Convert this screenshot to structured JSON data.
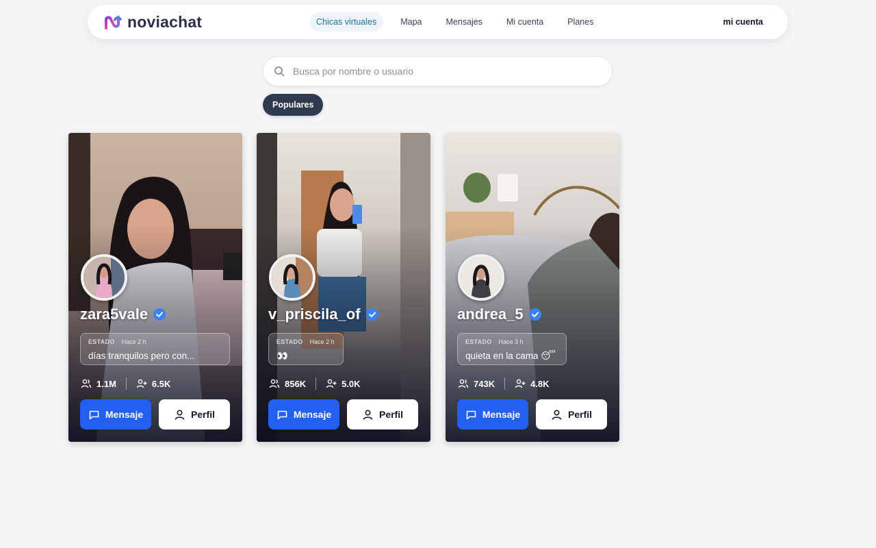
{
  "brand": {
    "name": "noviachat"
  },
  "nav": {
    "links": [
      {
        "label": "Chicas virtuales",
        "active": true
      },
      {
        "label": "Mapa",
        "active": false
      },
      {
        "label": "Mensajes",
        "active": false
      },
      {
        "label": "Mi cuenta",
        "active": false
      },
      {
        "label": "Planes",
        "active": false
      }
    ],
    "account_label": "mi cuenta"
  },
  "search": {
    "placeholder": "Busca por nombre o usuario",
    "value": ""
  },
  "filter": {
    "label": "Populares"
  },
  "colors": {
    "accent": "#2160f0",
    "verified": "#3b82f6",
    "chip": "#2f3a4e",
    "nav_active": "#1d6fa5"
  },
  "cards": [
    {
      "username": "zara5vale",
      "verified": true,
      "status_label": "ESTADO",
      "status_time": "Hace 2 h",
      "status_text": "días tranquilos pero con...",
      "followers": "1.1M",
      "following": "6.5K",
      "message_label": "Mensaje",
      "profile_label": "Perfil"
    },
    {
      "username": "v_priscila_of",
      "verified": true,
      "status_label": "ESTADO",
      "status_time": "Hace 2 h",
      "status_text": "👀",
      "followers": "856K",
      "following": "5.0K",
      "message_label": "Mensaje",
      "profile_label": "Perfil"
    },
    {
      "username": "andrea_5",
      "verified": true,
      "status_label": "ESTADO",
      "status_time": "Hace 3 h",
      "status_text": "quieta en la cama 😴",
      "followers": "743K",
      "following": "4.8K",
      "message_label": "Mensaje",
      "profile_label": "Perfil"
    }
  ]
}
